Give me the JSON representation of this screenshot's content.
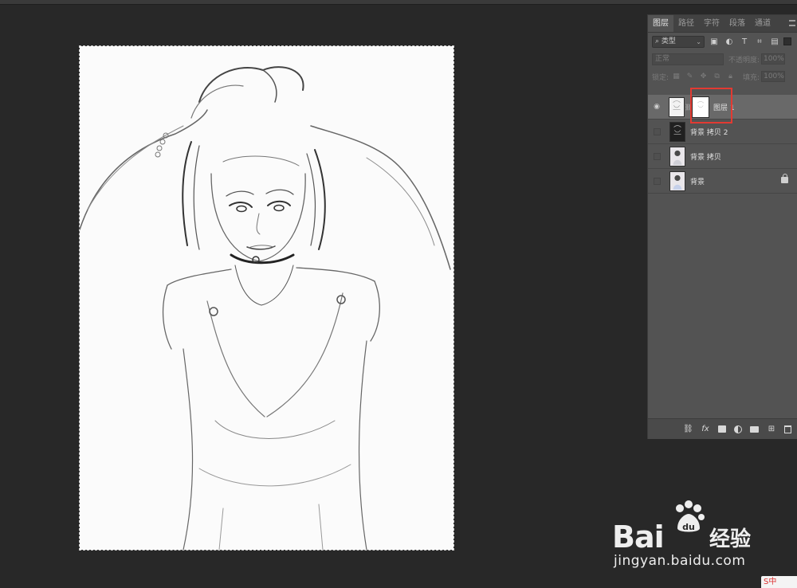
{
  "panel": {
    "tabs": [
      "图层",
      "路径",
      "字符",
      "段落",
      "通道"
    ],
    "active_tab": "图层",
    "filter_kind": "类型",
    "blend_mode": "正常",
    "opacity_label": "不透明度:",
    "opacity_value": "100%",
    "lock_label": "锁定:",
    "fill_label": "填充:",
    "fill_value": "100%",
    "layers": [
      {
        "name": "图层 1",
        "visible": true,
        "selected": true,
        "has_mask": true
      },
      {
        "name": "背景 拷贝 2",
        "visible": false,
        "selected": false
      },
      {
        "name": "背景 拷贝",
        "visible": false,
        "selected": false
      },
      {
        "name": "背景",
        "visible": false,
        "selected": false,
        "locked": true
      }
    ]
  },
  "watermark": {
    "brand": "Bai",
    "brand_suffix": "经验",
    "domain": "jingyan.baidu.com"
  },
  "ime_badge": "S中",
  "colors": {
    "background": "#282828",
    "panel": "#535353",
    "selected_layer": "#696969",
    "highlight": "#e23a32"
  }
}
